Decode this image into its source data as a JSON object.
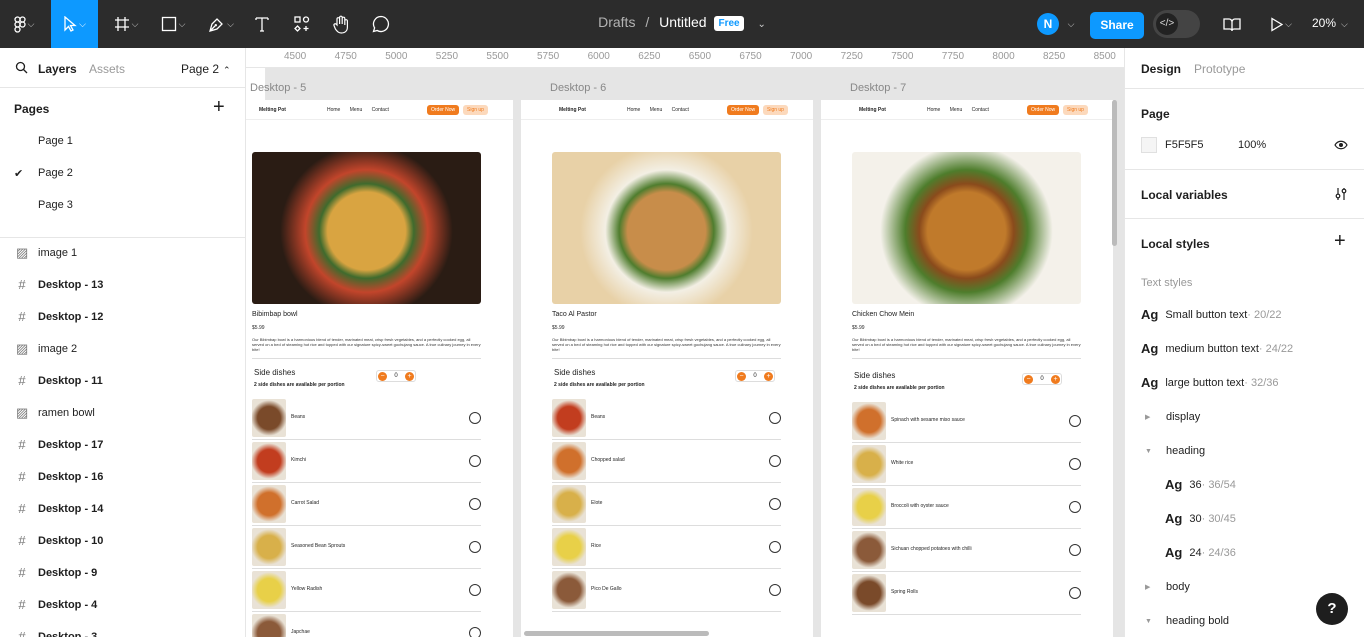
{
  "toolbar": {
    "breadcrumb_project": "Drafts",
    "separator": "/",
    "file_name": "Untitled",
    "plan_badge": "Free",
    "user_initial": "N",
    "share_label": "Share",
    "zoom_label": "20%",
    "icons": [
      "figma-menu-icon",
      "move-tool-icon",
      "frame-tool-icon",
      "rectangle-tool-icon",
      "pen-tool-icon",
      "text-tool-icon",
      "component-tool-icon",
      "hand-tool-icon",
      "comment-tool-icon",
      "dev-mode-icon",
      "library-icon",
      "present-icon"
    ]
  },
  "left_panel": {
    "tab_layers": "Layers",
    "tab_assets": "Assets",
    "current_page": "Page 2",
    "pages_heading": "Pages",
    "pages": [
      {
        "label": "Page 1",
        "selected": false
      },
      {
        "label": "Page 2",
        "selected": true
      },
      {
        "label": "Page 3",
        "selected": false
      }
    ],
    "layers": [
      {
        "label": "image 1",
        "kind": "image"
      },
      {
        "label": "Desktop - 13",
        "kind": "frame"
      },
      {
        "label": "Desktop - 12",
        "kind": "frame"
      },
      {
        "label": "image 2",
        "kind": "image"
      },
      {
        "label": "Desktop - 11",
        "kind": "frame"
      },
      {
        "label": "ramen bowl",
        "kind": "image"
      },
      {
        "label": "Desktop - 17",
        "kind": "frame"
      },
      {
        "label": "Desktop - 16",
        "kind": "frame"
      },
      {
        "label": "Desktop - 14",
        "kind": "frame"
      },
      {
        "label": "Desktop - 10",
        "kind": "frame"
      },
      {
        "label": "Desktop - 9",
        "kind": "frame"
      },
      {
        "label": "Desktop - 4",
        "kind": "frame"
      },
      {
        "label": "Desktop - 3",
        "kind": "frame"
      }
    ]
  },
  "canvas": {
    "ruler_x": [
      "4500",
      "4750",
      "5000",
      "5250",
      "5500",
      "5750",
      "6000",
      "6250",
      "6500",
      "6750",
      "7000",
      "7250",
      "7500",
      "7750",
      "8000",
      "8250",
      "8500"
    ],
    "ruler_y": [
      "-750",
      "-500",
      "-250",
      "0",
      "250",
      "500",
      "750",
      "1000",
      "1250",
      "1500"
    ],
    "frames": [
      {
        "label": "Desktop - 5",
        "nav": {
          "logo": "Melting Pot",
          "links": "Home Menu Contact",
          "order": "Order Now",
          "signup": "Sign up"
        },
        "dish_name": "Bibimbap bowl",
        "price": "$5.99",
        "description": "Our Bibimbap bowl is a harmonious blend of tender, marinated meat, crisp fresh vegetables, and a perfectly cooked egg, all served on a bed of steaming hot rice and topped with our signature spicy-sweet gochujang sauce. A true culinary journey in every bite!",
        "side_title": "Side dishes",
        "side_subtitle": "2 side dishes are available per portion",
        "count": "0",
        "sides": [
          "Beans",
          "Kimchi",
          "Carrot Salad",
          "Seasoned Bean Sprouts",
          "Yellow Radish",
          "Japchae"
        ]
      },
      {
        "label": "Desktop - 6",
        "nav": {
          "logo": "Melting Pot",
          "links": "Home Menu Contact",
          "order": "Order Now",
          "signup": "Sign up"
        },
        "dish_name": "Taco Al Pastor",
        "price": "$5.99",
        "description": "Our Bibimbap bowl is a harmonious blend of tender, marinated meat, crisp fresh vegetables, and a perfectly cooked egg, all served on a bed of steaming hot rice and topped with our signature spicy-sweet gochujang sauce. A true culinary journey in every bite!",
        "side_title": "Side dishes",
        "side_subtitle": "2 side dishes are available per portion",
        "count": "0",
        "sides": [
          "Beans",
          "Chopped salad",
          "Elote",
          "Rice",
          "Pico De Gallo"
        ]
      },
      {
        "label": "Desktop - 7",
        "nav": {
          "logo": "Melting Pot",
          "links": "Home Menu Contact",
          "order": "Order Now",
          "signup": "Sign up"
        },
        "dish_name": "Chicken Chow Mein",
        "price": "$5.99",
        "description": "Our Bibimbap bowl is a harmonious blend of tender, marinated meat, crisp fresh vegetables, and a perfectly cooked egg, all served on a bed of steaming hot rice and topped with our signature spicy-sweet gochujang sauce. A true culinary journey in every bite!",
        "side_title": "Side dishes",
        "side_subtitle": "2 side dishes are available per portion",
        "count": "0",
        "sides": [
          "Spinach with sesame miso sauce",
          "White rice",
          "Broccoli with oyster sauce",
          "Sichuan chopped potatoes with chilli",
          "Spring Rolls"
        ]
      }
    ]
  },
  "right_panel": {
    "tab_design": "Design",
    "tab_prototype": "Prototype",
    "page_heading": "Page",
    "page_color": "F5F5F5",
    "page_opacity": "100%",
    "local_variables": "Local variables",
    "local_styles": "Local styles",
    "text_styles_heading": "Text styles",
    "text_styles": [
      {
        "ag": "Ag",
        "name": "Small button text",
        "size": " · 20/22"
      },
      {
        "ag": "Ag",
        "name": "medium button text",
        "size": " · 24/22"
      },
      {
        "ag": "Ag",
        "name": "large button text",
        "size": " · 32/36"
      }
    ],
    "groups": [
      {
        "name": "display",
        "expanded": false
      },
      {
        "name": "heading",
        "expanded": true
      },
      {
        "name": "body",
        "expanded": false
      },
      {
        "name": "heading bold",
        "expanded": true
      }
    ],
    "heading_styles": [
      {
        "ag": "Ag",
        "name": "36",
        "size": " · 36/54"
      },
      {
        "ag": "Ag",
        "name": "30",
        "size": " · 30/45"
      },
      {
        "ag": "Ag",
        "name": "24",
        "size": " · 24/36"
      }
    ]
  },
  "help_label": "?",
  "colors": {
    "accent": "#0d99ff",
    "toolbar": "#2c2c2c",
    "brand_orange": "#f07b1e",
    "canvas": "#e5e5e5"
  }
}
